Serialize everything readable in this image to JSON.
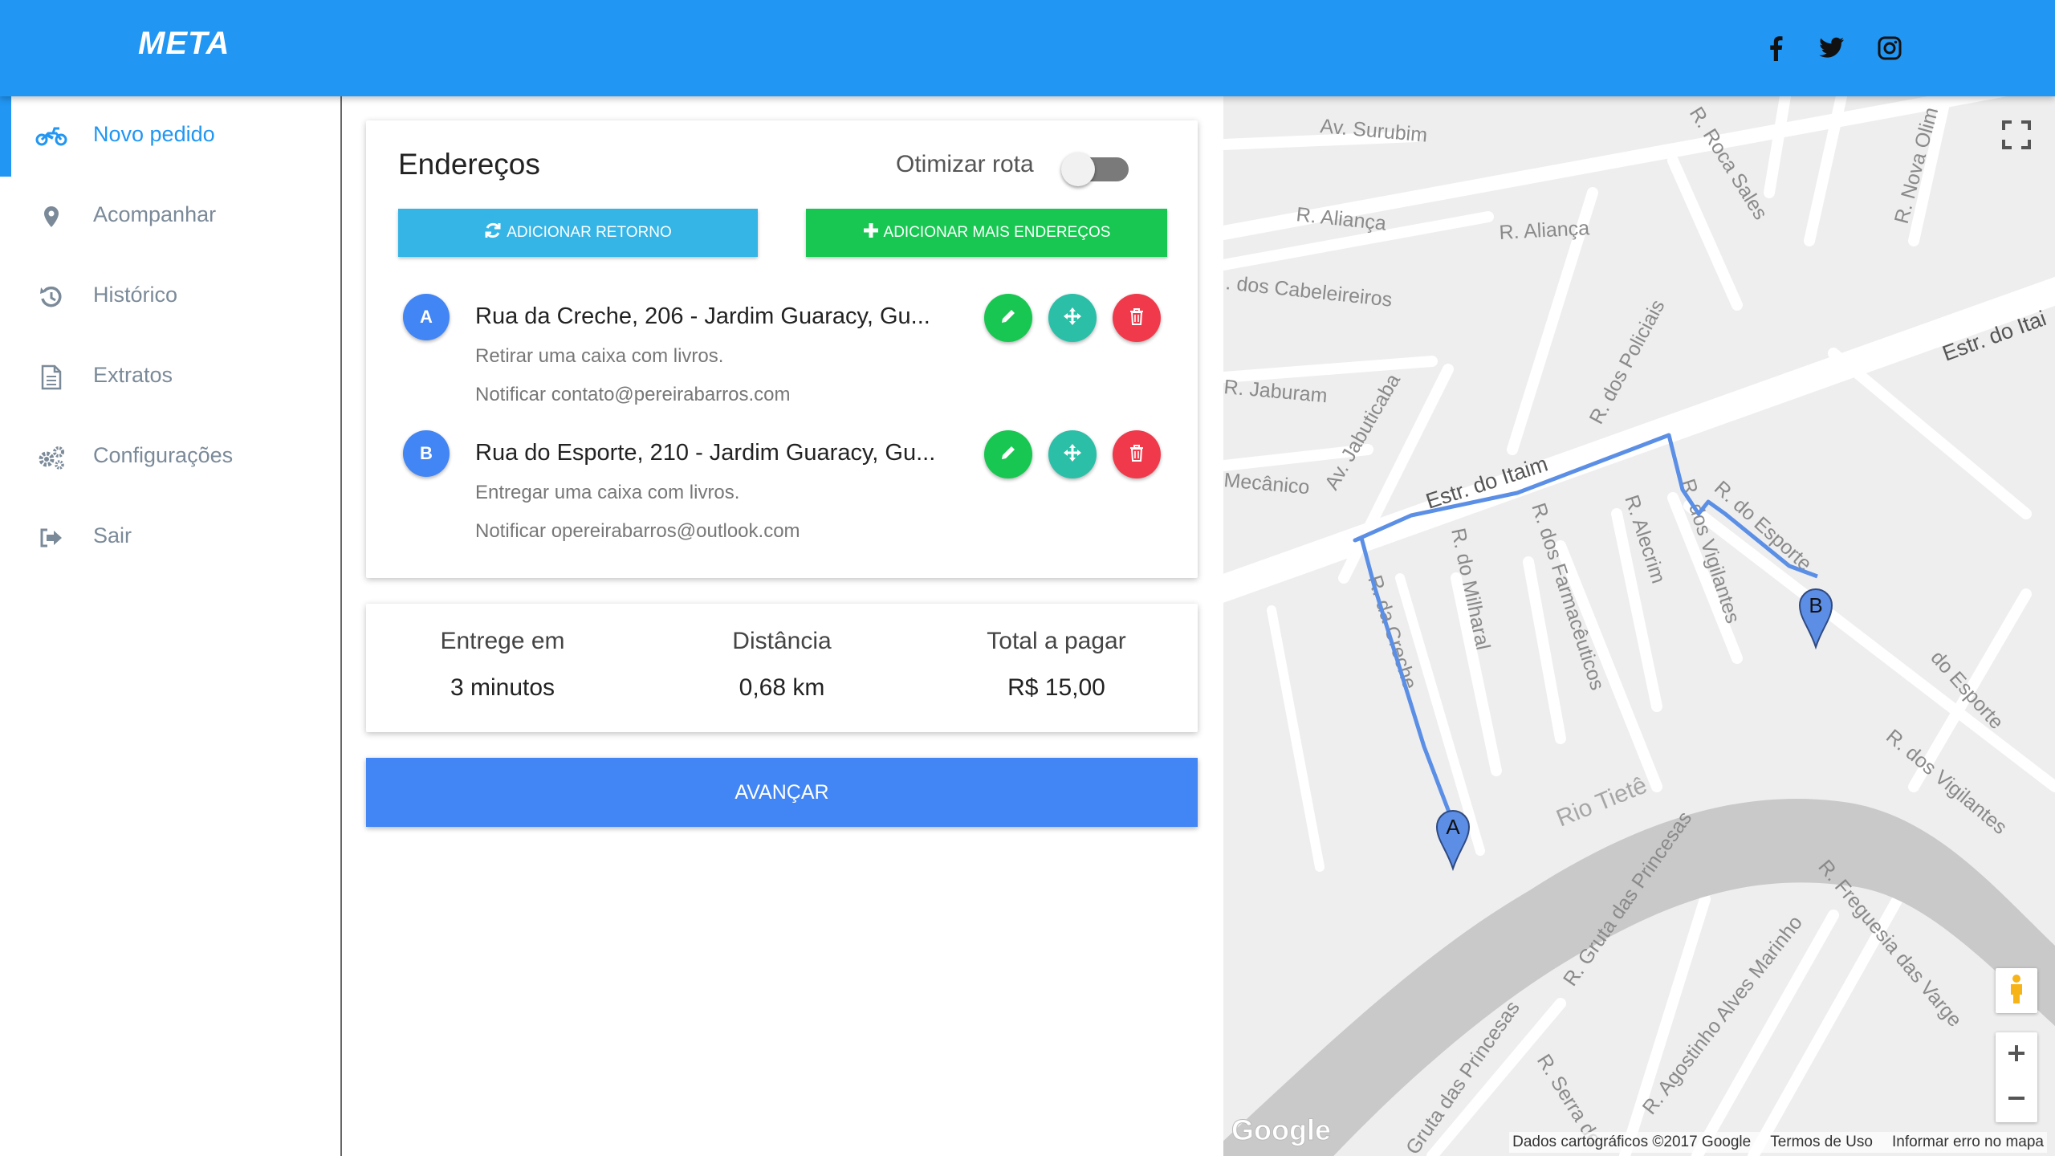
{
  "header": {
    "logo": "META",
    "social": [
      "facebook-icon",
      "twitter-icon",
      "instagram-icon"
    ],
    "bg_color": "#2196F3"
  },
  "sidebar": {
    "items": [
      {
        "label": "Novo pedido",
        "icon": "motorcycle-icon",
        "active": true
      },
      {
        "label": "Acompanhar",
        "icon": "map-pin-icon"
      },
      {
        "label": "Histórico",
        "icon": "history-icon"
      },
      {
        "label": "Extratos",
        "icon": "document-icon"
      },
      {
        "label": "Configurações",
        "icon": "gears-icon"
      },
      {
        "label": "Sair",
        "icon": "sign-out-icon"
      }
    ]
  },
  "addresses": {
    "title": "Endereços",
    "optimize_label": "Otimizar rota",
    "optimize_on": false,
    "btn_retorno": "ADICIONAR RETORNO",
    "btn_mais": "ADICIONAR MAIS ENDEREÇOS",
    "stops": [
      {
        "marker": "A",
        "address": "Rua da Creche, 206 - Jardim Guaracy, Gu...",
        "note": "Retirar uma caixa com livros.",
        "notify": "Notificar contato@pereirabarros.com"
      },
      {
        "marker": "B",
        "address": "Rua do Esporte, 210 - Jardim Guaracy, Gu...",
        "note": "Entregar uma caixa com livros.",
        "notify": "Notificar opereirabarros@outlook.com"
      }
    ]
  },
  "summary": {
    "delivery_label": "Entrege em",
    "delivery_value": "3 minutos",
    "distance_label": "Distância",
    "distance_value": "0,68 km",
    "total_label": "Total a pagar",
    "total_value": "R$ 15,00"
  },
  "advance_label": "AVANÇAR",
  "map": {
    "streets": {
      "surubim": "Av. Surubim",
      "alianca1": "R. Aliança",
      "alianca2": "R. Aliança",
      "cabeleireiros": ". dos Cabeleireiros",
      "jaburam": "R. Jaburam",
      "mecanico": "Mecânico",
      "jabuticaba": "Av. Jabuticaba",
      "policiais": "R. dos Policiais",
      "itaim1": "Estr. do Itaim",
      "itaim2": "Estr. do Itai",
      "roca": "R. Roca Sales",
      "nova": "R. Nova Olim",
      "milharal": "R. do Milharal",
      "farmaceuticos": "R. dos Farmacêuticos",
      "alecrim": "R. Alecrim",
      "vigilantes1": "R. dos Vigilantes",
      "esporte1": "R. do Esporte",
      "esporte2": "do Esporte",
      "vigilantes2": "R. dos Vigilantes",
      "creche": "R. da Creche",
      "tiete": "Rio Tietê",
      "princesas1": "R. Gruta das Princesas",
      "princesas2": "Gruta das Princesas",
      "freguesia": "R. Freguesia das Varge",
      "agostinho": "R. Agostinho Alves Marinho",
      "serra": "R. Serra de"
    },
    "google_logo": "Google",
    "footer": {
      "data": "Dados cartográficos ©2017 Google",
      "terms": "Termos de Uso",
      "report": "Informar erro no mapa"
    },
    "marker_a": "A",
    "marker_b": "B",
    "route_color": "#5b8fe6"
  }
}
